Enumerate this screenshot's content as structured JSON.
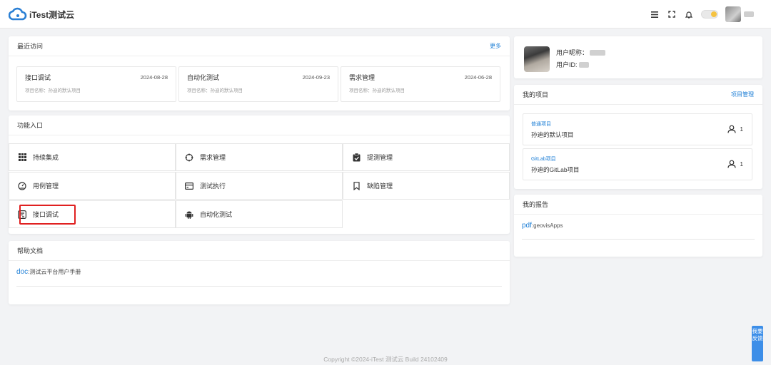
{
  "app": {
    "logo_text": "iTest测试云"
  },
  "recent": {
    "title": "最近访问",
    "more_label": "更多",
    "items": [
      {
        "name": "接口调试",
        "date": "2024-08-28",
        "project": "项目名称：孙迪的默认项目"
      },
      {
        "name": "自动化测试",
        "date": "2024-09-23",
        "project": "项目名称：孙迪的默认项目"
      },
      {
        "name": "需求管理",
        "date": "2024-06-28",
        "project": "项目名称：孙迪的默认项目"
      }
    ]
  },
  "functions": {
    "title": "功能入口",
    "items": [
      {
        "label": "持续集成",
        "icon": "grid-icon"
      },
      {
        "label": "需求管理",
        "icon": "target-icon"
      },
      {
        "label": "提测管理",
        "icon": "clipboard-check-icon"
      },
      {
        "label": "用例管理",
        "icon": "gauge-icon"
      },
      {
        "label": "测试执行",
        "icon": "card-icon"
      },
      {
        "label": "缺陷管理",
        "icon": "bookmark-icon"
      },
      {
        "label": "接口调试",
        "icon": "api-icon"
      },
      {
        "label": "自动化测试",
        "icon": "android-icon"
      }
    ]
  },
  "help": {
    "title": "帮助文档",
    "doc_tag": "doc",
    "doc_text": ":测试云平台用户手册"
  },
  "profile": {
    "nickname_label": "用户昵称：",
    "id_label": "用户ID:"
  },
  "projects": {
    "title": "我的项目",
    "manage_label": "项目管理",
    "items": [
      {
        "type": "普通项目",
        "name": "孙迪的默认项目",
        "members": "1"
      },
      {
        "type": "GitLab项目",
        "name": "孙迪的GitLab项目",
        "members": "1"
      }
    ]
  },
  "reports": {
    "title": "我的报告",
    "tag": "pdf",
    "text": ":geovisApps"
  },
  "footer": {
    "text": "Copyright ©2024-iTest 测试云 Build 24102409"
  },
  "feedback": {
    "label": "我要反馈"
  },
  "colors": {
    "accent": "#1e7fd6",
    "highlight": "#e02020",
    "feedback_bg": "#3d8ee8"
  }
}
